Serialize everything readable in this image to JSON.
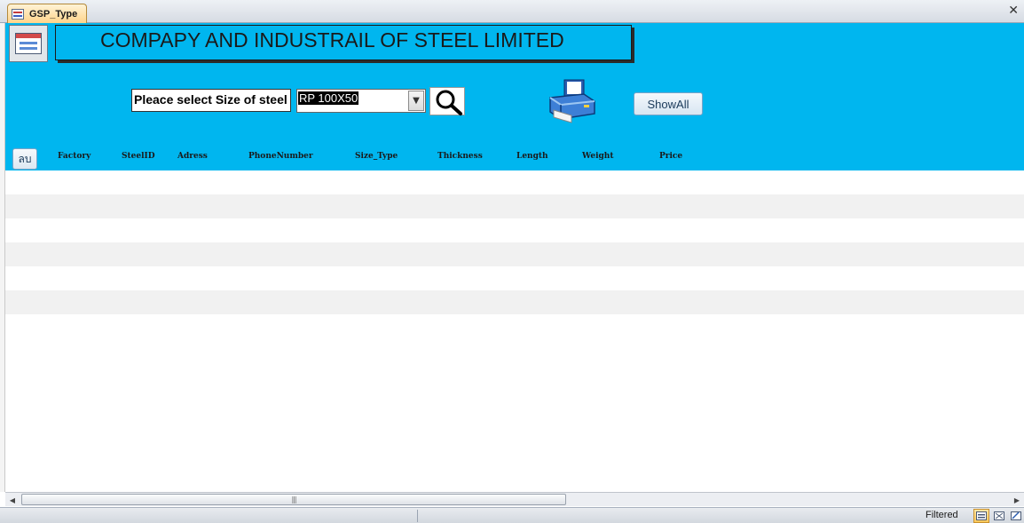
{
  "tab": {
    "title": "GSP_Type",
    "icon": "form-icon"
  },
  "header": {
    "title": "COMPAPY AND INDUSTRAIL OF STEEL LIMITED",
    "select_label": "Pleace select  Size of steel",
    "combo_value": "RP 100X50",
    "showall_label": "ShowAll",
    "delete_label": "ลบ"
  },
  "columns": [
    "Factory",
    "SteelID",
    "Adress",
    "PhoneNumber",
    "Size_Type",
    "Thickness",
    "Length",
    "Weight",
    "Price"
  ],
  "status": {
    "filter_text": "Filtered"
  },
  "colors": {
    "header_bg": "#00b6ef",
    "alt_row": "#f1f1f1"
  }
}
